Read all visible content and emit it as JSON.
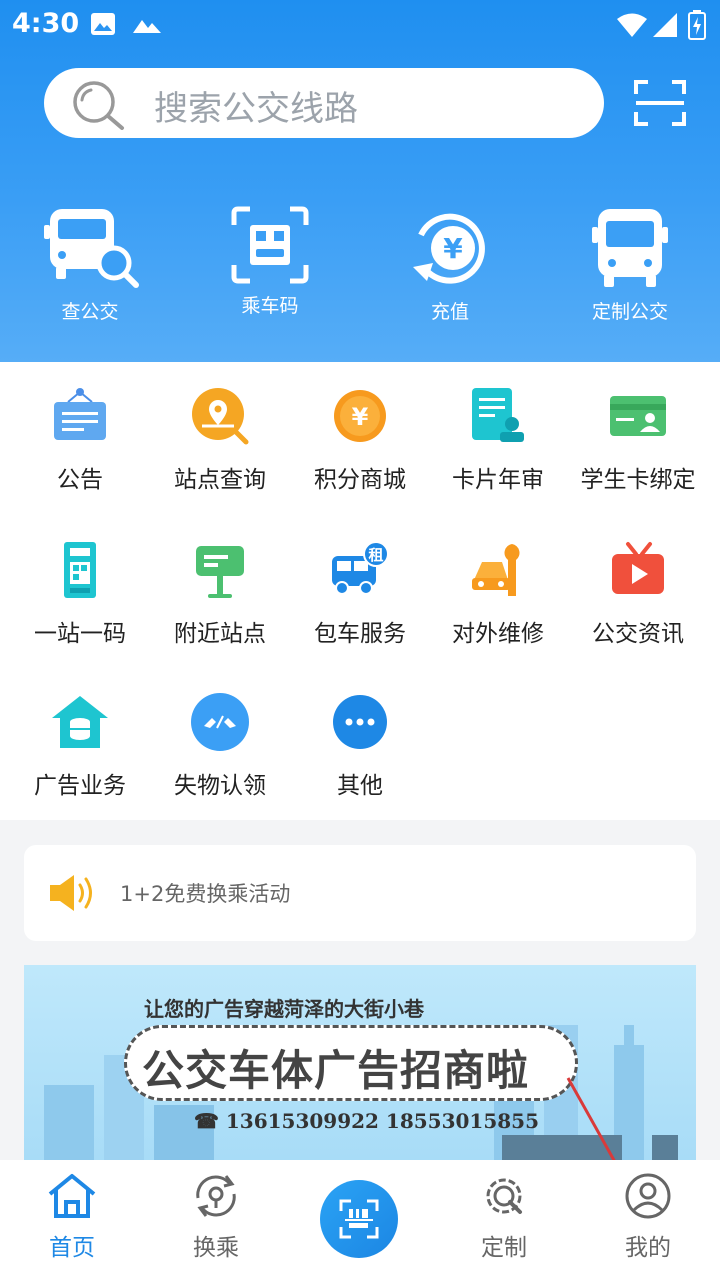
{
  "status_bar": {
    "time": "4:30"
  },
  "search": {
    "placeholder": "搜索公交线路"
  },
  "quick_actions": [
    {
      "label": "查公交",
      "icon": "bus-search-icon"
    },
    {
      "label": "乘车码",
      "icon": "qr-ride-code-icon"
    },
    {
      "label": "充值",
      "icon": "recharge-yuan-icon"
    },
    {
      "label": "定制公交",
      "icon": "bus-icon"
    }
  ],
  "services": [
    {
      "label": "公告",
      "icon": "announcement-board-icon"
    },
    {
      "label": "站点查询",
      "icon": "location-search-icon"
    },
    {
      "label": "积分商城",
      "icon": "yuan-coin-icon"
    },
    {
      "label": "卡片年审",
      "icon": "card-review-icon"
    },
    {
      "label": "学生卡绑定",
      "icon": "student-card-icon"
    },
    {
      "label": "一站一码",
      "icon": "station-code-icon"
    },
    {
      "label": "附近站点",
      "icon": "bus-stop-sign-icon"
    },
    {
      "label": "包车服务",
      "icon": "charter-bus-icon"
    },
    {
      "label": "对外维修",
      "icon": "repair-wrench-icon"
    },
    {
      "label": "公交资讯",
      "icon": "tv-news-icon"
    },
    {
      "label": "广告业务",
      "icon": "ad-house-icon"
    },
    {
      "label": "失物认领",
      "icon": "lost-found-icon"
    },
    {
      "label": "其他",
      "icon": "more-dots-icon"
    }
  ],
  "notice": {
    "text": "1+2免费换乘活动"
  },
  "banner": {
    "line1": "让您的广告穿越菏泽的大街小巷",
    "title": "公交车体广告招商啦",
    "phone": "☎ 13615309922 18553015855"
  },
  "tabs": [
    {
      "label": "首页",
      "active": true,
      "icon": "home-icon"
    },
    {
      "label": "换乘",
      "active": false,
      "icon": "transfer-icon"
    },
    {
      "label": "定制",
      "active": false,
      "icon": "custom-gear-icon"
    },
    {
      "label": "我的",
      "active": false,
      "icon": "profile-icon"
    }
  ],
  "colors": {
    "primary": "#1e88e5",
    "header": "#2b95f2",
    "orange": "#f5a623",
    "teal": "#1ec5d0"
  }
}
